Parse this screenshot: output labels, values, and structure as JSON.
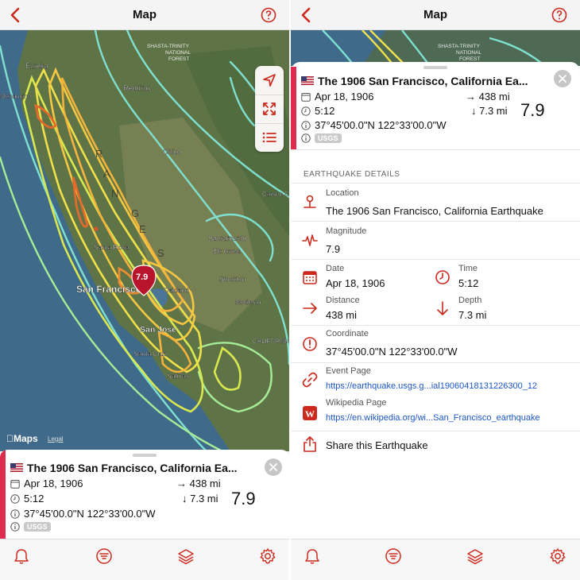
{
  "nav": {
    "title": "Map"
  },
  "map": {
    "places": [
      "Eureka",
      "Redding",
      "Mendocino",
      "Chico",
      "Carson City",
      "Sacramento",
      "Elk Grove",
      "Santa Rosa",
      "San Francisco",
      "Oakland",
      "Stockton",
      "Modesto",
      "San Jose",
      "Santa Cruz",
      "Salinas",
      "CALIFORNIA"
    ],
    "forest_label": [
      "SHASTA-TRINITY",
      "NATIONAL",
      "FOREST"
    ],
    "range_letters": [
      "R",
      "A",
      "N",
      "G",
      "E",
      "S"
    ],
    "pin_magnitude": "7.9",
    "maps_logo": "Maps",
    "legal": "Legal"
  },
  "quake": {
    "title": "The 1906 San Francisco, California Ea...",
    "date": "Apr 18, 1906",
    "time": "5:12",
    "coordinate": "37°45'00.0\"N 122°33'00.0\"W",
    "source": "USGS",
    "distance": "438 mi",
    "depth": "7.3 mi",
    "magnitude": "7.9"
  },
  "details": {
    "section_title": "EARTHQUAKE DETAILS",
    "location_label": "Location",
    "location_value": "The 1906 San Francisco, California Earthquake",
    "magnitude_label": "Magnitude",
    "magnitude_value": "7.9",
    "date_label": "Date",
    "date_value": "Apr 18, 1906",
    "time_label": "Time",
    "time_value": "5:12",
    "distance_label": "Distance",
    "distance_value": "438 mi",
    "depth_label": "Depth",
    "depth_value": "7.3 mi",
    "coordinate_label": "Coordinate",
    "coordinate_value": "37°45'00.0\"N 122°33'00.0\"W",
    "event_label": "Event Page",
    "event_link": "https://earthquake.usgs.g...ial19060418131226300_12",
    "wiki_label": "Wikipedia Page",
    "wiki_link": "https://en.wikipedia.org/wi...San_Francisco_earthquake",
    "share_label": "Share this Earthquake"
  },
  "colors": {
    "accent": "#cc2a1e",
    "card_accent": "#dd2c4e",
    "link": "#1b56c9"
  },
  "icons": [
    "back-chevron-icon",
    "help-icon",
    "location-arrow-icon",
    "fit-expand-icon",
    "list-icon",
    "flag-icon",
    "calendar-icon",
    "clock-icon",
    "info-icon",
    "arrow-right-icon",
    "arrow-down-icon",
    "close-icon",
    "pin-icon",
    "waveform-icon",
    "link-icon",
    "wikipedia-icon",
    "share-icon",
    "bell-icon",
    "filter-icon",
    "layers-icon",
    "gear-icon"
  ]
}
